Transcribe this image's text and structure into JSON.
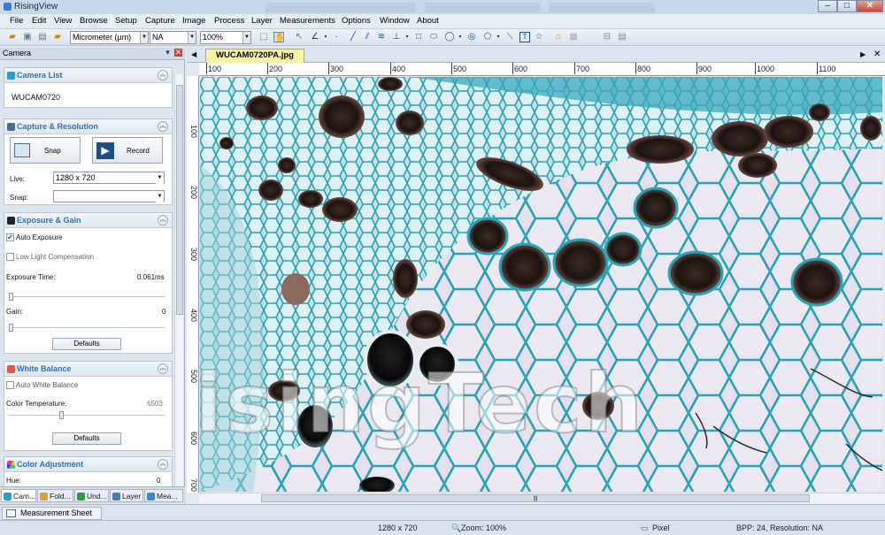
{
  "window": {
    "title": "RisingView",
    "minimize": "–",
    "maximize": "□",
    "close": "✕"
  },
  "menu": [
    "File",
    "Edit",
    "View",
    "Browse",
    "Setup",
    "Capture",
    "Image",
    "Process",
    "Layer",
    "Measurements",
    "Options",
    "Window",
    "About"
  ],
  "toolbar": {
    "unit": "Micrometer (µm)",
    "magnification": "NA",
    "zoom": "100%"
  },
  "left_pane": {
    "title": "Camera",
    "camera_list": {
      "title": "Camera List",
      "camera": "WUCAM0720"
    },
    "capture": {
      "title": "Capture & Resolution",
      "snap_label": "Snap",
      "record_label": "Record",
      "live_label": "Live:",
      "live_value": "1280 x 720",
      "snap_field_label": "Snap:",
      "snap_value": ""
    },
    "exposure": {
      "title": "Exposure & Gain",
      "auto_exposure": "Auto Exposure",
      "auto_exposure_checked": true,
      "low_light": "Low Light Compensation",
      "exposure_time_label": "Exposure Time:",
      "exposure_time_value": "0.061ms",
      "gain_label": "Gain:",
      "gain_value": "0",
      "defaults": "Defaults"
    },
    "white_balance": {
      "title": "White Balance",
      "auto_wb": "Auto White Balance",
      "color_temp_label": "Color Temperature:",
      "color_temp_value": "6503",
      "defaults": "Defaults"
    },
    "color_adjustment": {
      "title": "Color Adjustment",
      "hue_label": "Hue:",
      "hue_value": "0"
    },
    "tabs": [
      "Cam...",
      "Fold...",
      "Und...",
      "Layer",
      "Mea..."
    ]
  },
  "document": {
    "tab": "WUCAM0720PA.jpg",
    "watermark": "RisingTech",
    "hruler": [
      "100",
      "200",
      "300",
      "400",
      "500",
      "600",
      "700",
      "800",
      "900",
      "1000",
      "1100"
    ],
    "vruler": [
      "100",
      "200",
      "300",
      "400",
      "500",
      "600",
      "700"
    ]
  },
  "bottom_tab": "Measurement Sheet",
  "status": {
    "resolution": "1280 x 720",
    "zoom": "Zoom: 100%",
    "unit": "Pixel",
    "bpp": "BPP: 24, Resolution: NA"
  },
  "colors": {
    "accent": "#2f6fbf",
    "tab_active": "#fbf3a4",
    "stain": "#2aa3b8"
  }
}
